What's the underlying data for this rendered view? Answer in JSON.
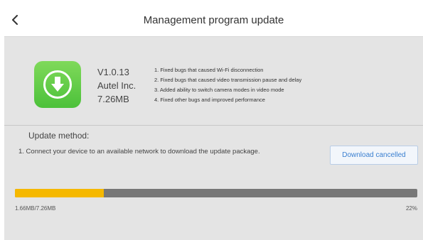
{
  "header": {
    "title": "Management program update",
    "back_icon": "chevron-left-icon"
  },
  "app": {
    "icon": "download-arrow-icon",
    "icon_color": "#4cc13a",
    "version": "V1.0.13",
    "vendor": "Autel Inc.",
    "size": "7.26MB"
  },
  "release_notes": [
    "1. Fixed bugs that caused Wi-Fi disconnection",
    "2. Fixed bugs that caused video transmission pause and delay",
    "3. Added ability to switch camera modes in video mode",
    "4. Fixed other bugs and improved performance"
  ],
  "update_method": {
    "label": "Update method:",
    "step": "1. Connect your device to an available network to download the update package.",
    "button_label": "Download cancelled"
  },
  "progress": {
    "downloaded": "1.66MB/7.26MB",
    "percent_label": "22%",
    "fraction": 0.22,
    "fill_color": "#f5b800",
    "track_color": "#777777"
  }
}
